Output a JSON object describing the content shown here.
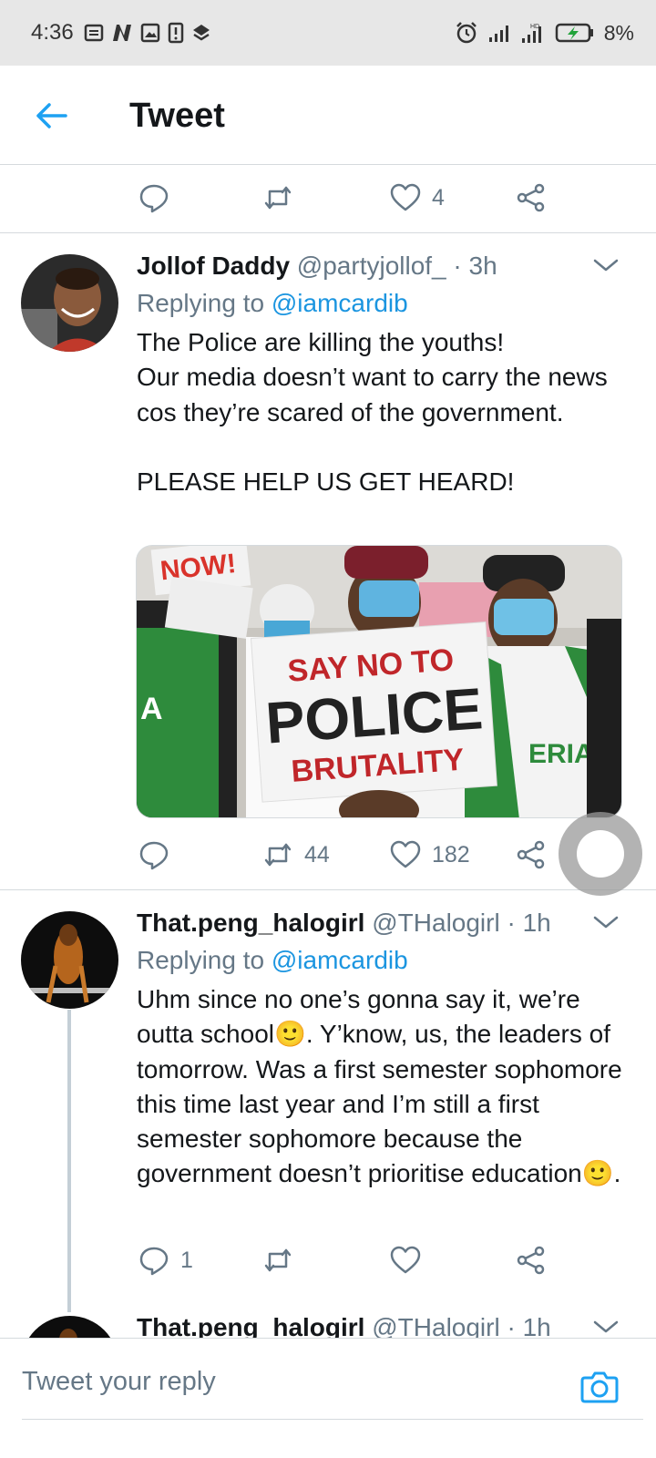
{
  "status_bar": {
    "time": "4:36",
    "battery": "8%"
  },
  "header": {
    "title": "Tweet"
  },
  "top_actions": {
    "like_count": "4"
  },
  "tweets": [
    {
      "name": "Jollof Daddy",
      "handle": "@partyjollof_ · 3h",
      "replying_prefix": "Replying to",
      "replying_to": "@iamcardib",
      "body": "The Police are killing the youths!\nOur media doesn’t want to carry the news cos they’re scared of the government.\n\nPLEASE HELP US GET HEARD!",
      "image_text": {
        "top": "NOW!",
        "line1": "SAY NO TO",
        "line2": "POLICE",
        "line3": "BRUTALITY",
        "shirt": "ERIA",
        "shirt_left": "A"
      },
      "retweets": "44",
      "likes": "182"
    },
    {
      "name": "That.peng_halogirl",
      "handle": "@THalogirl · 1h",
      "replying_prefix": "Replying to",
      "replying_to": "@iamcardib",
      "body": "Uhm since no one’s gonna say it, we’re outta school🙂. Y’know, us, the leaders of tomorrow. Was a first semester sophomore this time last year and I’m still a first semester sophomore because the government doesn’t prioritise education🙂.",
      "replies": "1"
    },
    {
      "name": "That.peng_halogirl",
      "handle": "@THalogirl · 1h"
    }
  ],
  "composer": {
    "placeholder": "Tweet your reply"
  },
  "colors": {
    "accent": "#1da1f2",
    "mention": "#1b95e0",
    "muted": "#657786",
    "text": "#14171a"
  }
}
